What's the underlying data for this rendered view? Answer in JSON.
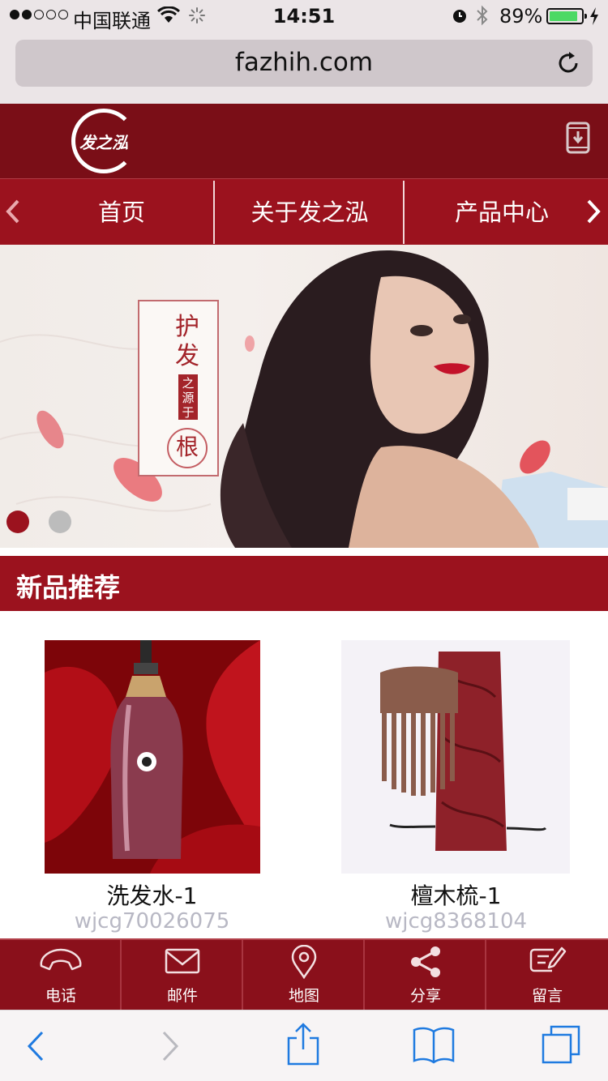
{
  "status_bar": {
    "carrier": "中国联通",
    "time": "14:51",
    "battery_text": "89%",
    "battery_level": 0.89
  },
  "address_bar": {
    "url": "fazhih.com"
  },
  "header": {
    "logo_text": "发之泓"
  },
  "nav": {
    "items": [
      {
        "label": "首页"
      },
      {
        "label": "关于发之泓"
      },
      {
        "label": "产品中心"
      }
    ]
  },
  "banner": {
    "line1": "护发",
    "tag": "之源于",
    "seal": "根",
    "active_slide": 1,
    "slides": 2
  },
  "section": {
    "title": "新品推荐"
  },
  "products": [
    {
      "name": "洗发水-1",
      "code": "wjcg70026075"
    },
    {
      "name": "檀木梳-1",
      "code": "wjcg8368104"
    }
  ],
  "toolbar": {
    "items": [
      {
        "label": "电话",
        "icon": "phone-icon"
      },
      {
        "label": "邮件",
        "icon": "mail-icon"
      },
      {
        "label": "地图",
        "icon": "map-pin-icon"
      },
      {
        "label": "分享",
        "icon": "share-icon"
      },
      {
        "label": "留言",
        "icon": "message-icon"
      }
    ]
  },
  "colors": {
    "header": "#7a0e17",
    "nav": "#9b121e",
    "toolbar": "#8a101b",
    "safari_blue": "#1f7ae0"
  }
}
